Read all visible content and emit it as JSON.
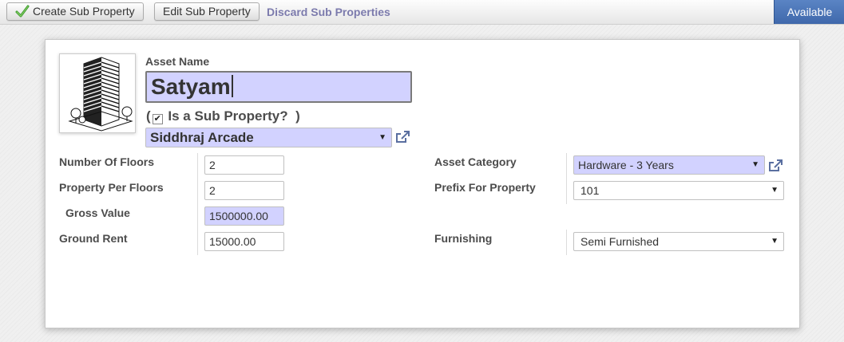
{
  "toolbar": {
    "create_label": "Create Sub Property",
    "edit_label": "Edit Sub Property",
    "discard_label": "Discard Sub Properties",
    "status": "Available"
  },
  "form": {
    "asset_name_label": "Asset Name",
    "asset_name_value": "Satyam",
    "is_sub_property_label": "Is a Sub Property?",
    "is_sub_property_checked": true,
    "parent_property": "Siddhraj Arcade",
    "fields_left": [
      {
        "label": "Number Of Floors",
        "value": "2"
      },
      {
        "label": "Property Per Floors",
        "value": "2"
      },
      {
        "label": "Gross Value",
        "value": "1500000.00"
      },
      {
        "label": "Ground Rent",
        "value": "15000.00"
      }
    ],
    "fields_right": [
      {
        "label": "Asset Category",
        "value": "Hardware - 3 Years"
      },
      {
        "label": "Prefix For Property",
        "value": "101"
      },
      {
        "label": "Furnishing",
        "value": "Semi Furnished"
      }
    ]
  },
  "colors": {
    "required_field_bg": "#d2d2ff",
    "status_bg": "#3f68ab",
    "discard_link": "#7c7bad"
  },
  "icons": [
    "check-icon",
    "building-photo",
    "external-link-icon",
    "dropdown-arrow-icon"
  ]
}
